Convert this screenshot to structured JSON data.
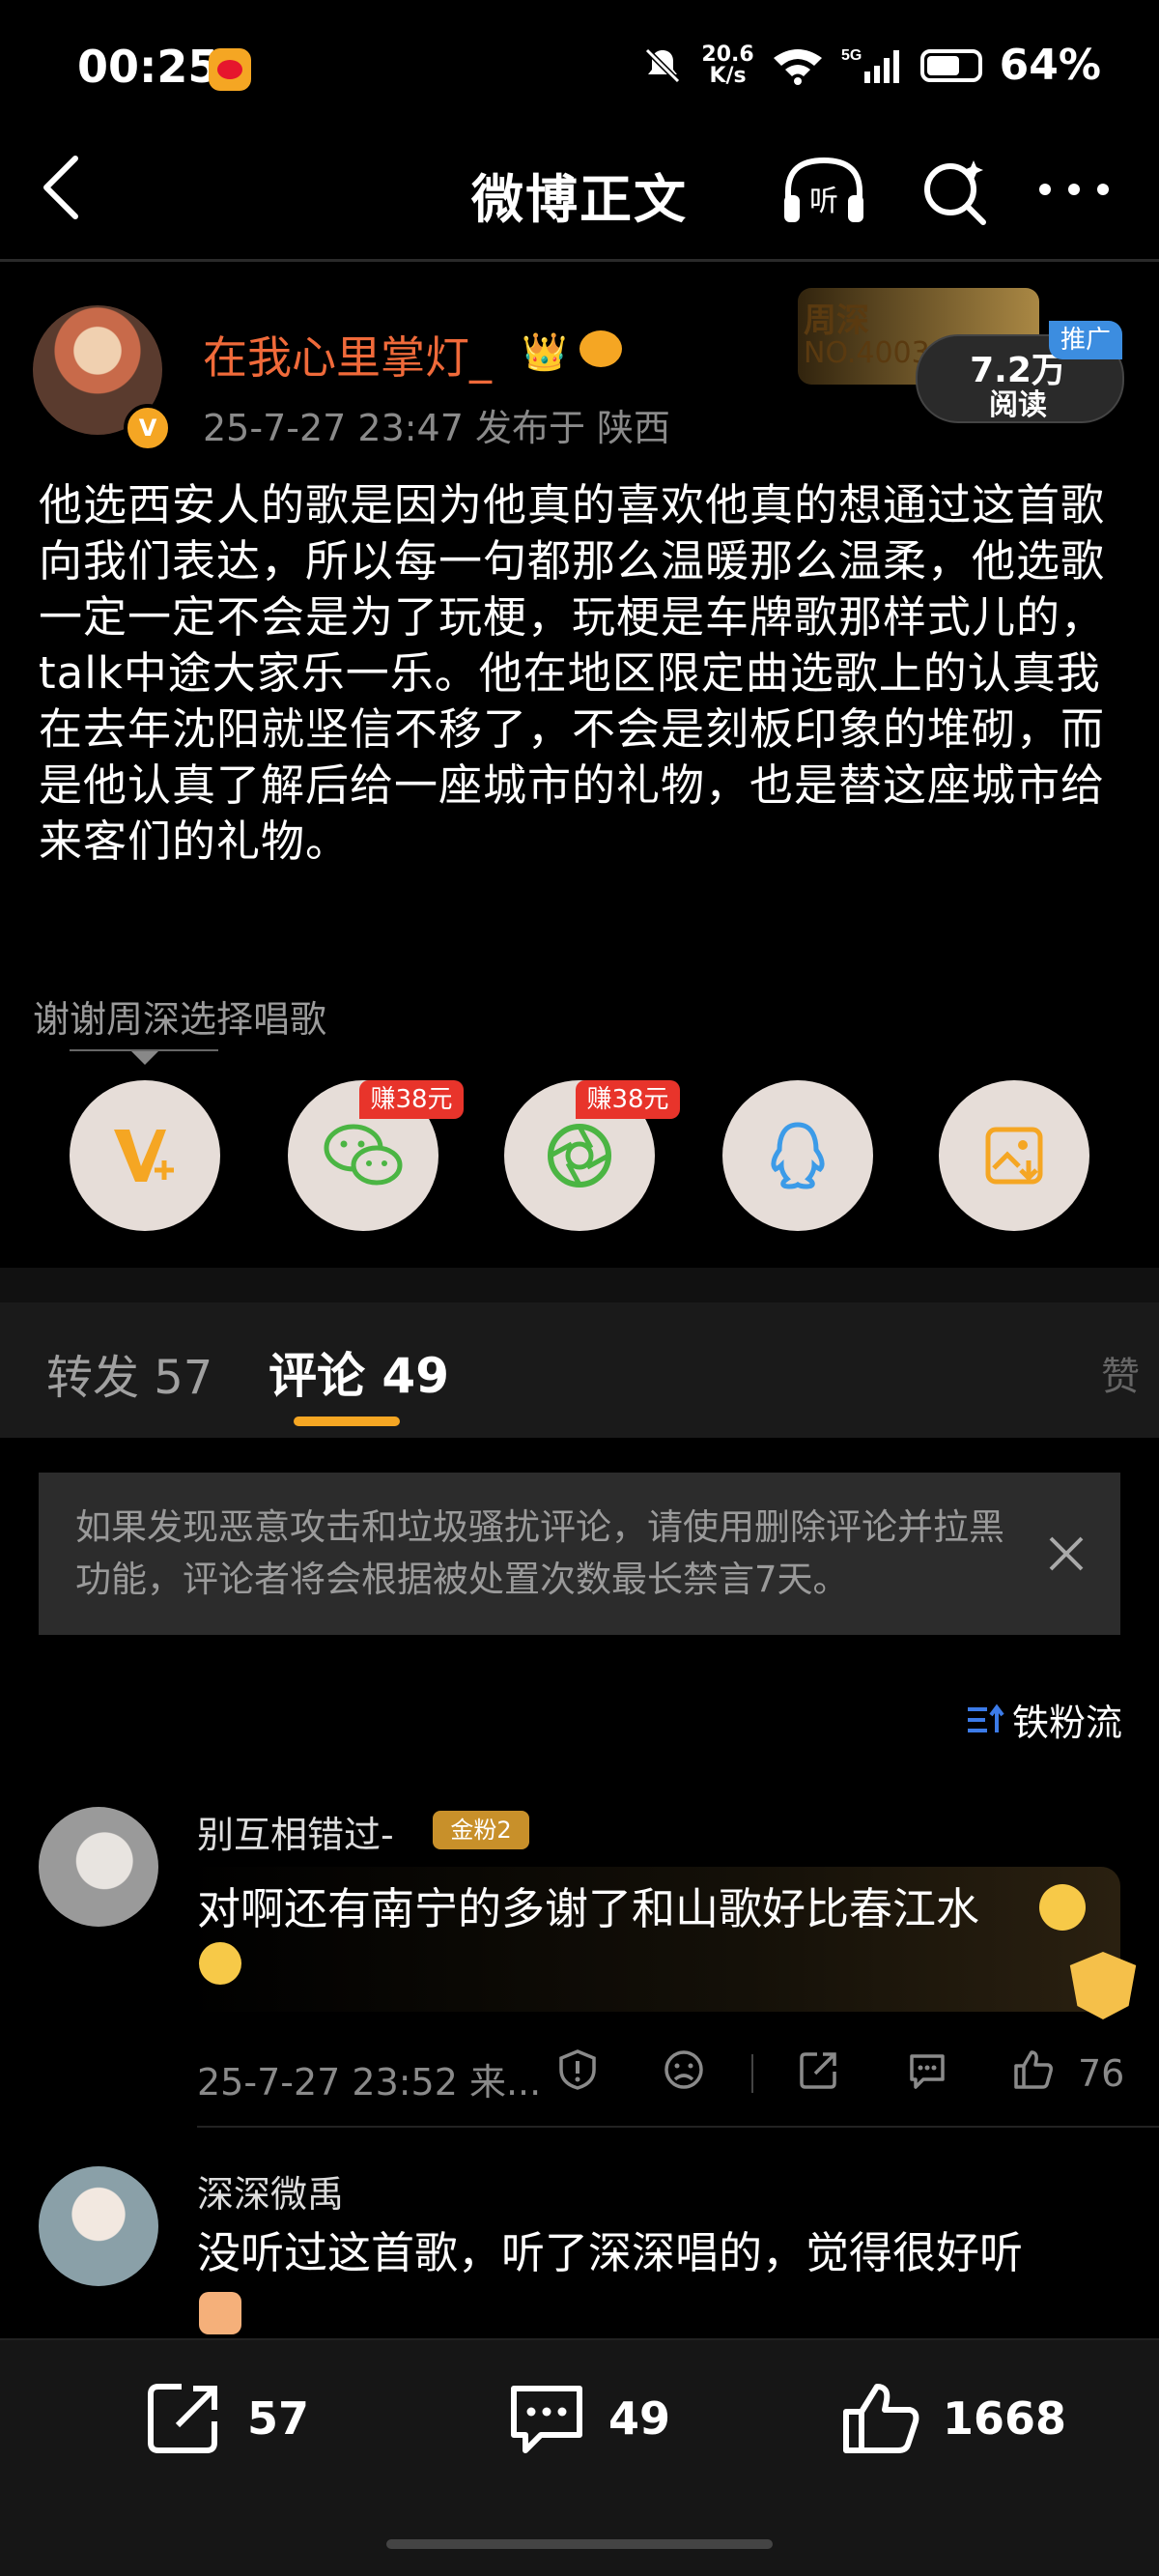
{
  "status_bar": {
    "time": "00:25",
    "net_speed_top": "20.6",
    "net_speed_bottom": "K/s",
    "network": "5G",
    "battery": "64%"
  },
  "nav": {
    "title": "微博正文"
  },
  "post": {
    "author": "在我心里掌灯_",
    "meta": "25-7-27 23:47   发布于 陕西",
    "fan_card_name": "周深",
    "fan_card_no": "NO.4003",
    "views": "7.2万",
    "views_label": "阅读",
    "promo": "推广",
    "body": "他选西安人的歌是因为他真的喜欢他真的想通过这首歌向我们表达，所以每一句都那么温暖那么温柔，他选歌一定一定不会是为了玩梗，玩梗是车牌歌那样式儿的，talk中途大家乐一乐。他在地区限定曲选歌上的认真我在去年沈阳就坚信不移了，不会是刻板印象的堆砌，而是他认真了解后给一座城市的礼物，也是替这座城市给来客们的礼物。",
    "thanks": "谢谢周深选择唱歌"
  },
  "share": {
    "earn_badge_1": "赚38元",
    "earn_badge_2": "赚38元"
  },
  "tabs": {
    "repost": "转发 57",
    "comment": "评论 49",
    "more": "赞"
  },
  "notice": {
    "text": "如果发现恶意攻击和垃圾骚扰评论，请使用删除评论并拉黑功能，评论者将会根据被处置次数最长禁言7天。"
  },
  "sort": {
    "label": "铁粉流"
  },
  "comments": [
    {
      "name": "别互相错过-",
      "badge": "金粉2",
      "text": "对啊还有南宁的多谢了和山歌好比春江水",
      "meta": "25-7-27 23:52  来...",
      "likes": "76"
    },
    {
      "name": "深深微禹",
      "text": "没听过这首歌，听了深深唱的，觉得很好听"
    }
  ],
  "bottom_bar": {
    "reposts": "57",
    "comments": "49",
    "likes": "1668"
  },
  "colors": {
    "accent": "#f5a623",
    "username": "#f06a3a",
    "earn_badge": "#e8342b"
  }
}
